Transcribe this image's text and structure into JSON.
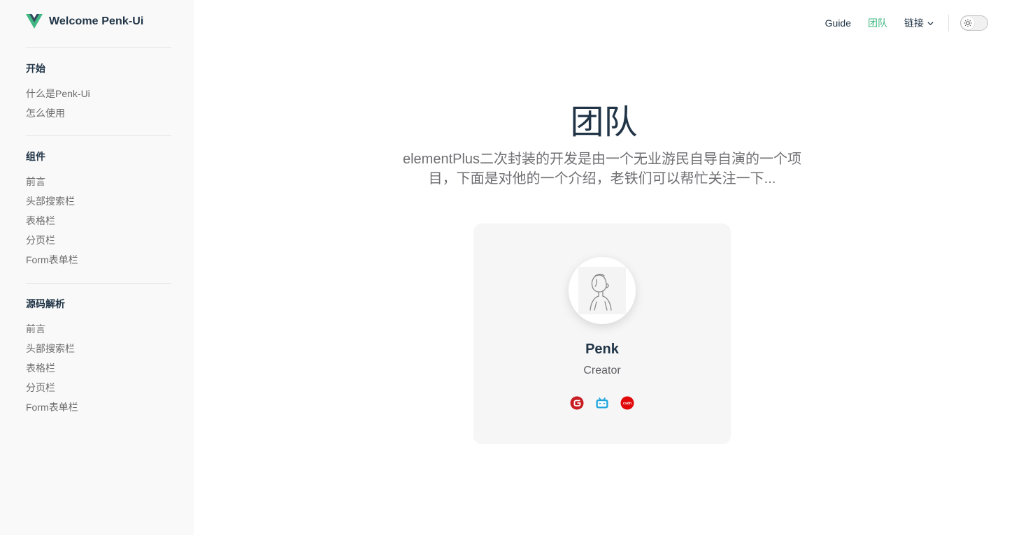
{
  "brand": {
    "title": "Welcome Penk-Ui",
    "logo_icon": "vue-logo-icon"
  },
  "nav": {
    "links": [
      {
        "label": "Guide",
        "active": false
      },
      {
        "label": "团队",
        "active": true
      }
    ],
    "dropdown_label": "链接",
    "theme_toggle_icon": "sun-icon"
  },
  "sidebar": {
    "groups": [
      {
        "title": "开始",
        "items": [
          "什么是Penk-Ui",
          "怎么使用"
        ]
      },
      {
        "title": "组件",
        "items": [
          "前言",
          "头部搜索栏",
          "表格栏",
          "分页栏",
          "Form表单栏"
        ]
      },
      {
        "title": "源码解析",
        "items": [
          "前言",
          "头部搜索栏",
          "表格栏",
          "分页栏",
          "Form表单栏"
        ]
      }
    ]
  },
  "team": {
    "title": "团队",
    "description": "elementPlus二次封装的开发是由一个无业游民自导自演的一个项目，下面是对他的一个介绍，老铁们可以帮忙关注一下...",
    "members": [
      {
        "name": "Penk",
        "role": "Creator",
        "links": [
          "gitee-icon",
          "bilibili-icon",
          "csdn-icon"
        ]
      }
    ]
  },
  "colors": {
    "accent": "#42b883",
    "text": "#213547",
    "sidebar_bg": "#f9f9f9",
    "card_bg": "#f6f6f7"
  }
}
